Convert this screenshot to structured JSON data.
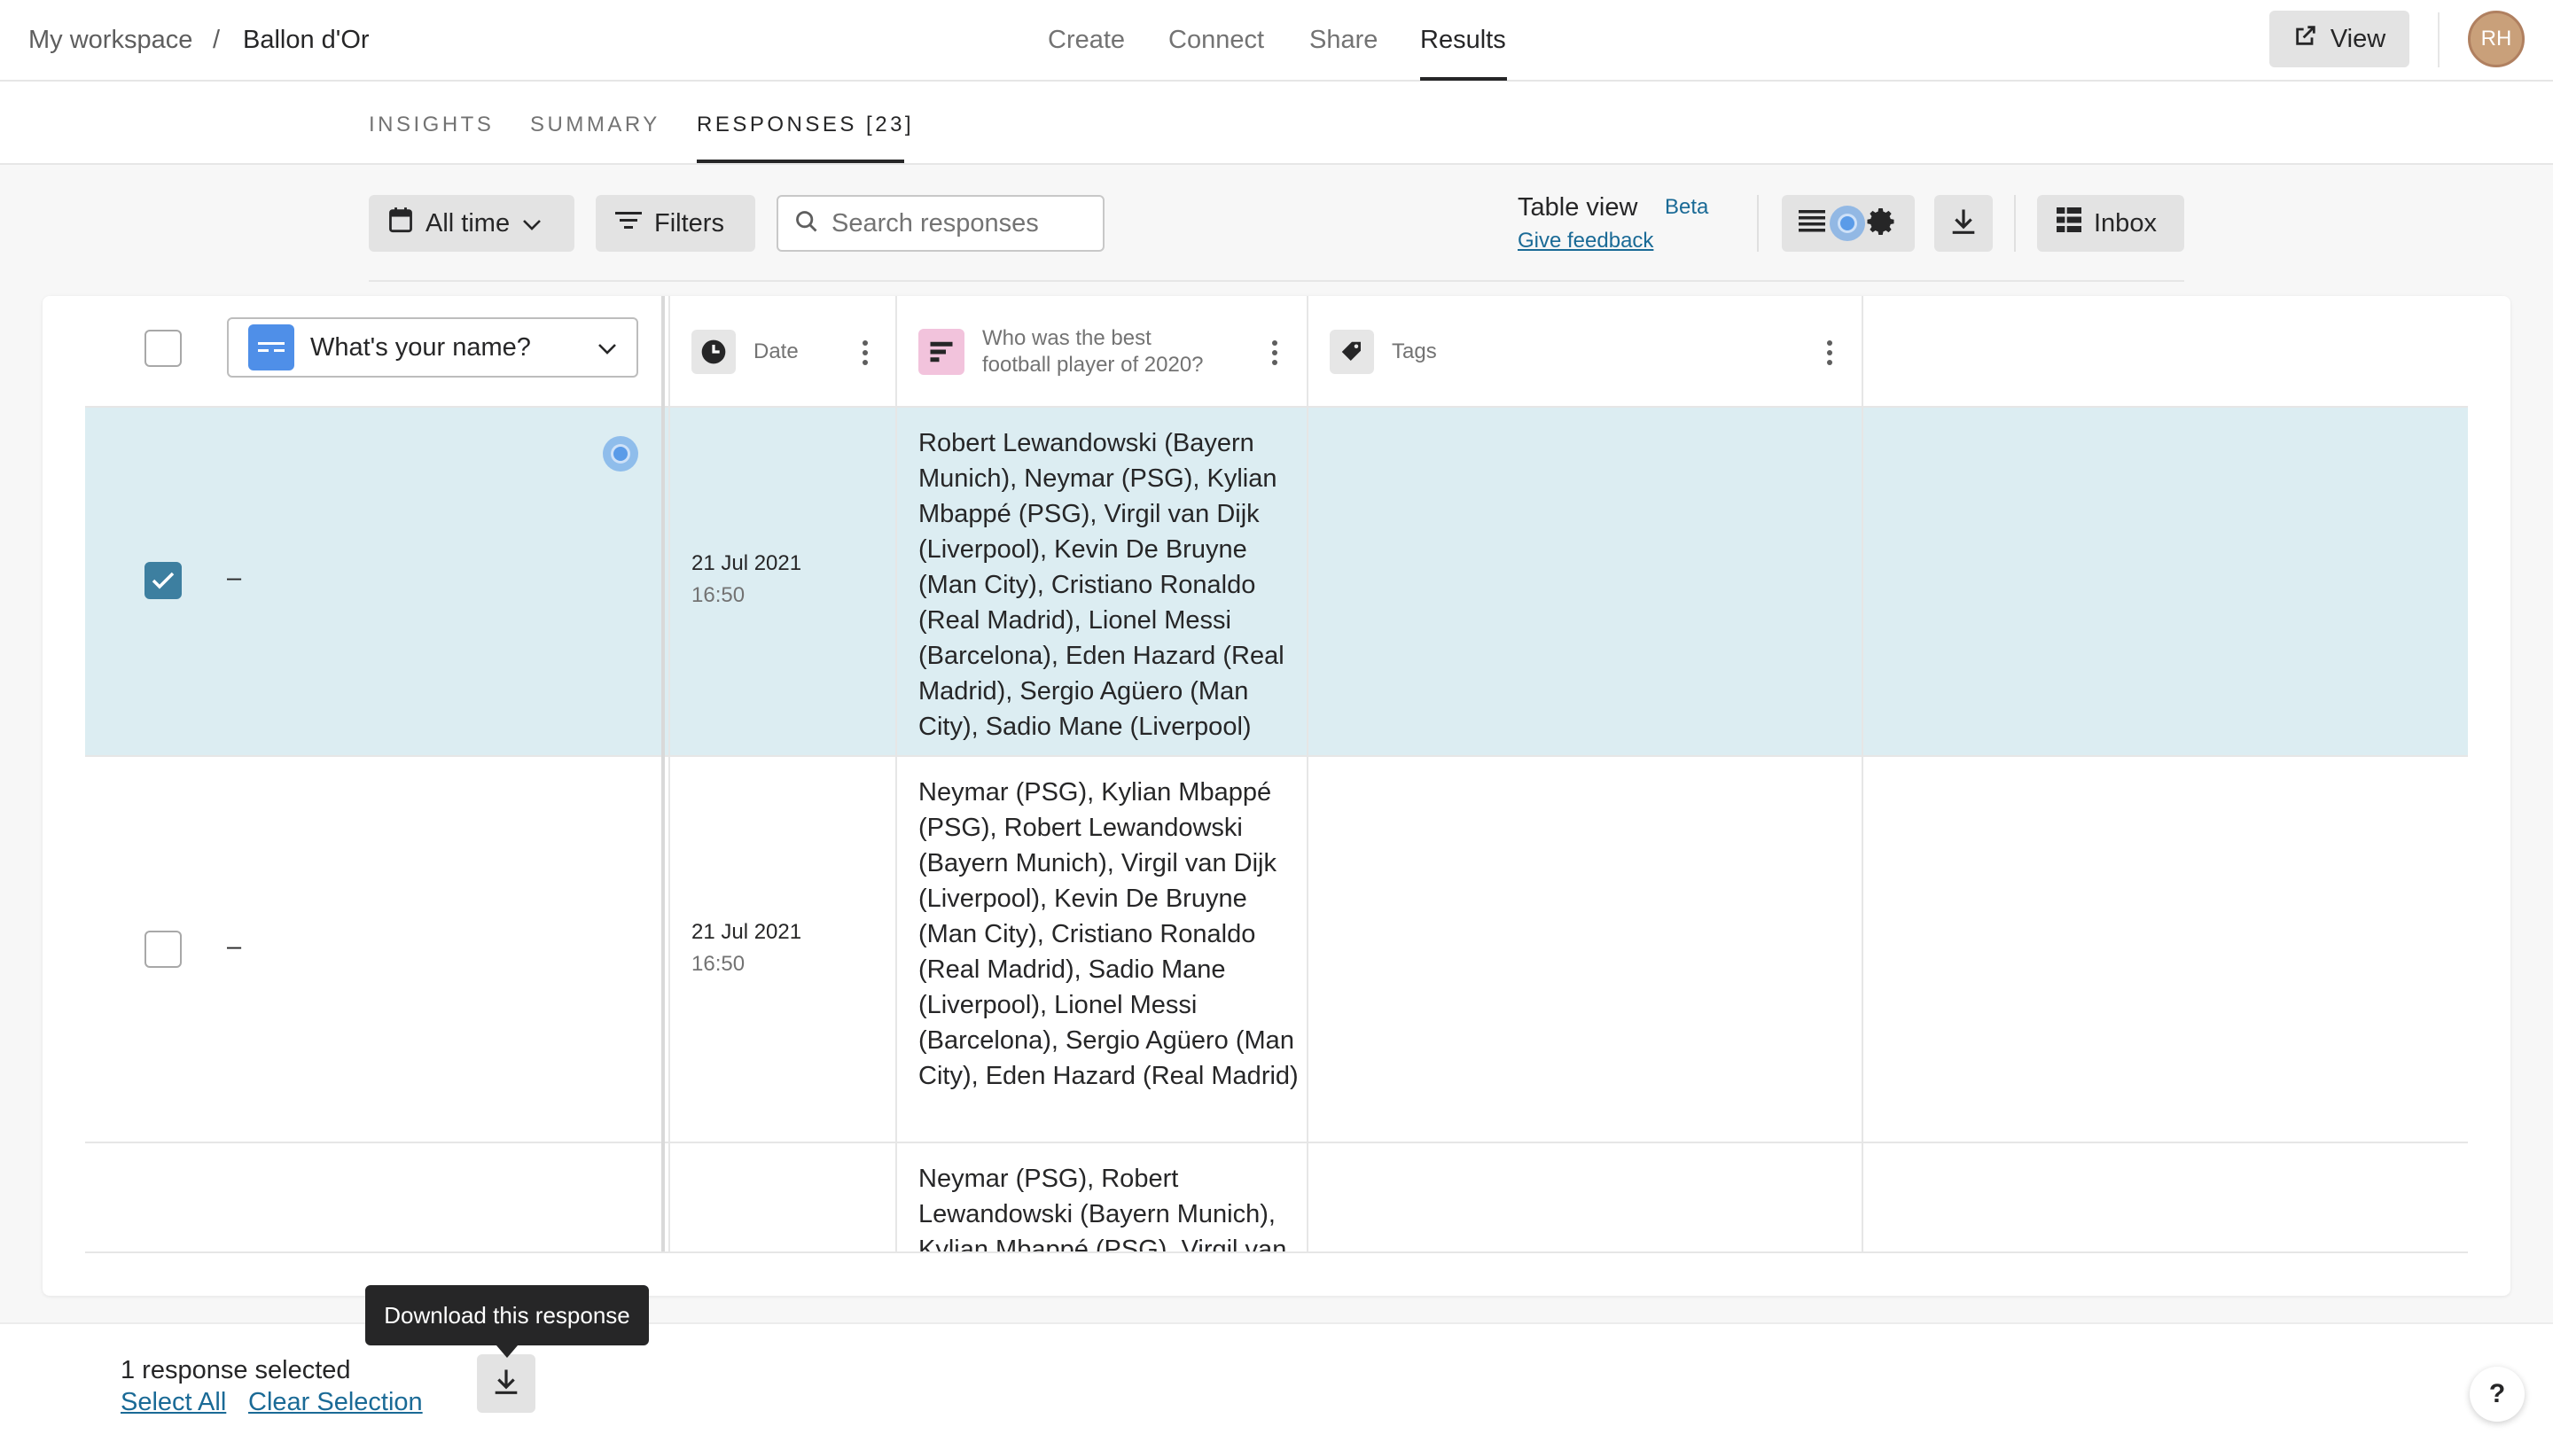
{
  "breadcrumb": {
    "workspace": "My workspace",
    "separator": "/",
    "form": "Ballon d'Or"
  },
  "nav": {
    "create": "Create",
    "connect": "Connect",
    "share": "Share",
    "results": "Results"
  },
  "header": {
    "view_label": "View",
    "avatar_initials": "RH"
  },
  "subtabs": {
    "insights": "INSIGHTS",
    "summary": "SUMMARY",
    "responses": "RESPONSES [23]"
  },
  "toolbar": {
    "date_filter": "All time",
    "filters": "Filters",
    "search_placeholder": "Search responses",
    "table_view": "Table view",
    "beta": "Beta",
    "feedback": "Give feedback",
    "inbox": "Inbox"
  },
  "table": {
    "name_column_select": "What's your name?",
    "columns": {
      "date": "Date",
      "question_line1": "Who was the best",
      "question_line2": "football player of 2020?",
      "tags": "Tags"
    },
    "rows": [
      {
        "selected": true,
        "name": "–",
        "date": "21 Jul 2021",
        "time": "16:50",
        "answer": "Robert Lewandowski (Bayern Munich), Neymar (PSG), Kylian Mbappé (PSG), Virgil van Dijk (Liverpool), Kevin De Bruyne (Man City), Cristiano Ronaldo (Real Madrid), Lionel Messi (Barcelona), Eden Hazard (Real Madrid), Sergio Agüero (Man City), Sadio Mane (Liverpool)"
      },
      {
        "selected": false,
        "name": "–",
        "date": "21 Jul 2021",
        "time": "16:50",
        "answer": "Neymar (PSG), Kylian Mbappé (PSG), Robert Lewandowski (Bayern Munich), Virgil van Dijk (Liverpool), Kevin De Bruyne (Man City), Cristiano Ronaldo (Real Madrid), Sadio Mane (Liverpool), Lionel Messi (Barcelona), Sergio Agüero (Man City), Eden Hazard (Real Madrid)"
      },
      {
        "selected": false,
        "name": "",
        "date": "",
        "time": "",
        "answer": "Neymar (PSG), Robert Lewandowski (Bayern Munich), Kylian Mbappé (PSG), Virgil van"
      }
    ]
  },
  "bottom": {
    "selected_count": "1 response selected",
    "select_all": "Select All",
    "clear_selection": "Clear Selection",
    "tooltip": "Download this response",
    "help": "?"
  },
  "colors": {
    "accent_link": "#1a6a96",
    "selected_row": "#dcedf2",
    "checkbox_checked": "#3d7fa0"
  }
}
